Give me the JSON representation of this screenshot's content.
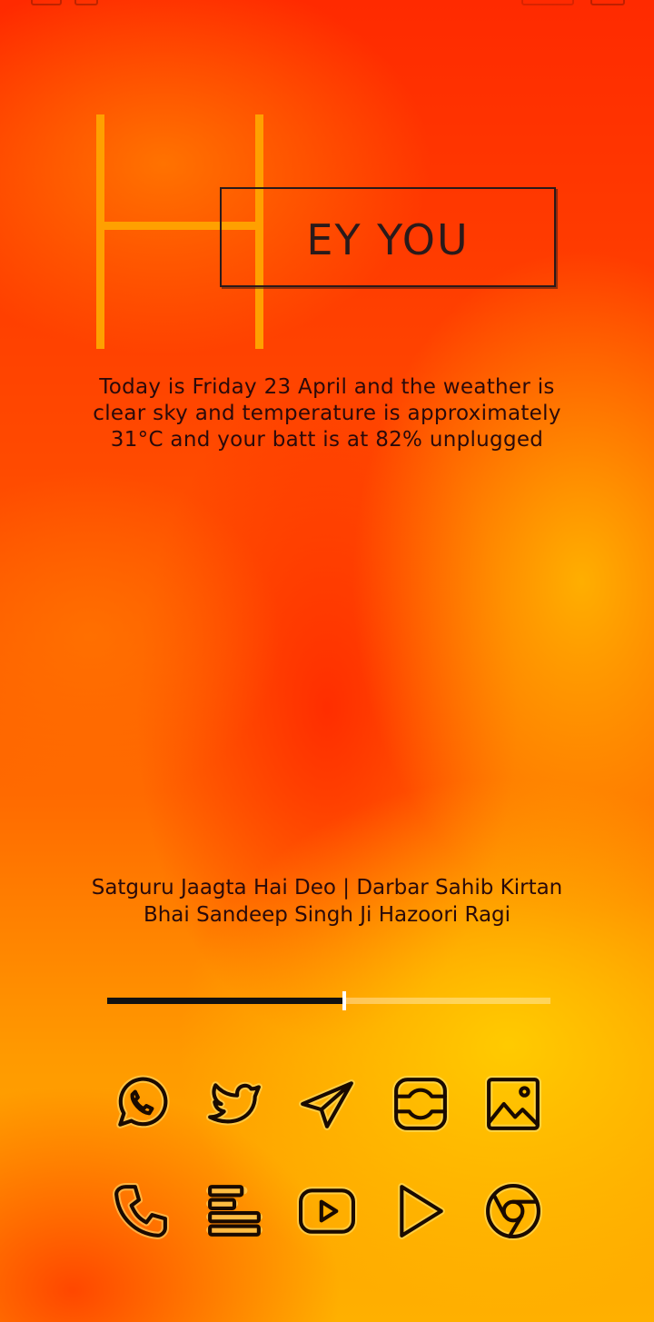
{
  "header": {
    "hey_text": "EY YOU"
  },
  "info": {
    "today_text": "Today is  Friday 23 April and the weather is clear sky and temperature is approximately 31°C and your batt is at 82% unplugged"
  },
  "music": {
    "title": "Satguru Jaagta Hai Deo | Darbar Sahib Kirtan Bhai Sandeep Singh Ji Hazoori Ragi",
    "progress_percent": 53.5
  },
  "apps": {
    "row1": [
      "whatsapp-icon",
      "twitter-icon",
      "telegram-icon",
      "camera-icon",
      "gallery-icon"
    ],
    "row2": [
      "phone-icon",
      "notes-icon",
      "youtube-icon",
      "play-store-icon",
      "chrome-icon"
    ]
  },
  "colors": {
    "accent_h": "#ffa000",
    "text": "#2a0a0a",
    "icon_stroke": "#1a0a00"
  }
}
